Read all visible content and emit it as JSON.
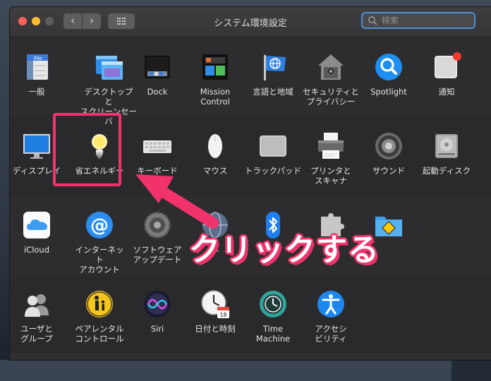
{
  "window": {
    "title": "システム環境設定"
  },
  "search": {
    "placeholder": "検索"
  },
  "callout": {
    "text": "クリックする"
  },
  "colors": {
    "highlight": "#f2336b",
    "search_focus": "#4a90d9"
  },
  "rows": [
    [
      {
        "label": "一般",
        "icon": "general-icon"
      },
      {
        "label": "デスクトップと\nスクリーンセーバ",
        "icon": "desktop-screensaver-icon"
      },
      {
        "label": "Dock",
        "icon": "dock-icon"
      },
      {
        "label": "Mission\nControl",
        "icon": "mission-control-icon"
      },
      {
        "label": "言語と地域",
        "icon": "language-region-icon"
      },
      {
        "label": "セキュリティと\nプライバシー",
        "icon": "security-privacy-icon"
      },
      {
        "label": "Spotlight",
        "icon": "spotlight-icon"
      },
      {
        "label": "通知",
        "icon": "notifications-icon"
      }
    ],
    [
      {
        "label": "ディスプレイ",
        "icon": "display-icon"
      },
      {
        "label": "省エネルギー",
        "icon": "energy-saver-icon"
      },
      {
        "label": "キーボード",
        "icon": "keyboard-icon"
      },
      {
        "label": "マウス",
        "icon": "mouse-icon"
      },
      {
        "label": "トラックパッド",
        "icon": "trackpad-icon"
      },
      {
        "label": "プリンタと\nスキャナ",
        "icon": "printer-scanner-icon"
      },
      {
        "label": "サウンド",
        "icon": "sound-icon"
      },
      {
        "label": "起動ディスク",
        "icon": "startup-disk-icon"
      }
    ],
    [
      {
        "label": "iCloud",
        "icon": "icloud-icon"
      },
      {
        "label": "インターネット\nアカウント",
        "icon": "internet-accounts-icon"
      },
      {
        "label": "ソフトウェア\nアップデート",
        "icon": "software-update-icon"
      },
      {
        "label": "ネ",
        "icon": "network-icon"
      },
      {
        "label": "",
        "icon": "bluetooth-icon"
      },
      {
        "label": "",
        "icon": "extensions-icon"
      },
      {
        "label": "",
        "icon": "sharing-icon"
      }
    ],
    [
      {
        "label": "ユーザと\nグループ",
        "icon": "users-groups-icon"
      },
      {
        "label": "ペアレンタル\nコントロール",
        "icon": "parental-controls-icon"
      },
      {
        "label": "Siri",
        "icon": "siri-icon"
      },
      {
        "label": "日付と時刻",
        "icon": "date-time-icon"
      },
      {
        "label": "Time\nMachine",
        "icon": "time-machine-icon"
      },
      {
        "label": "アクセシ\nビリティ",
        "icon": "accessibility-icon"
      }
    ]
  ]
}
